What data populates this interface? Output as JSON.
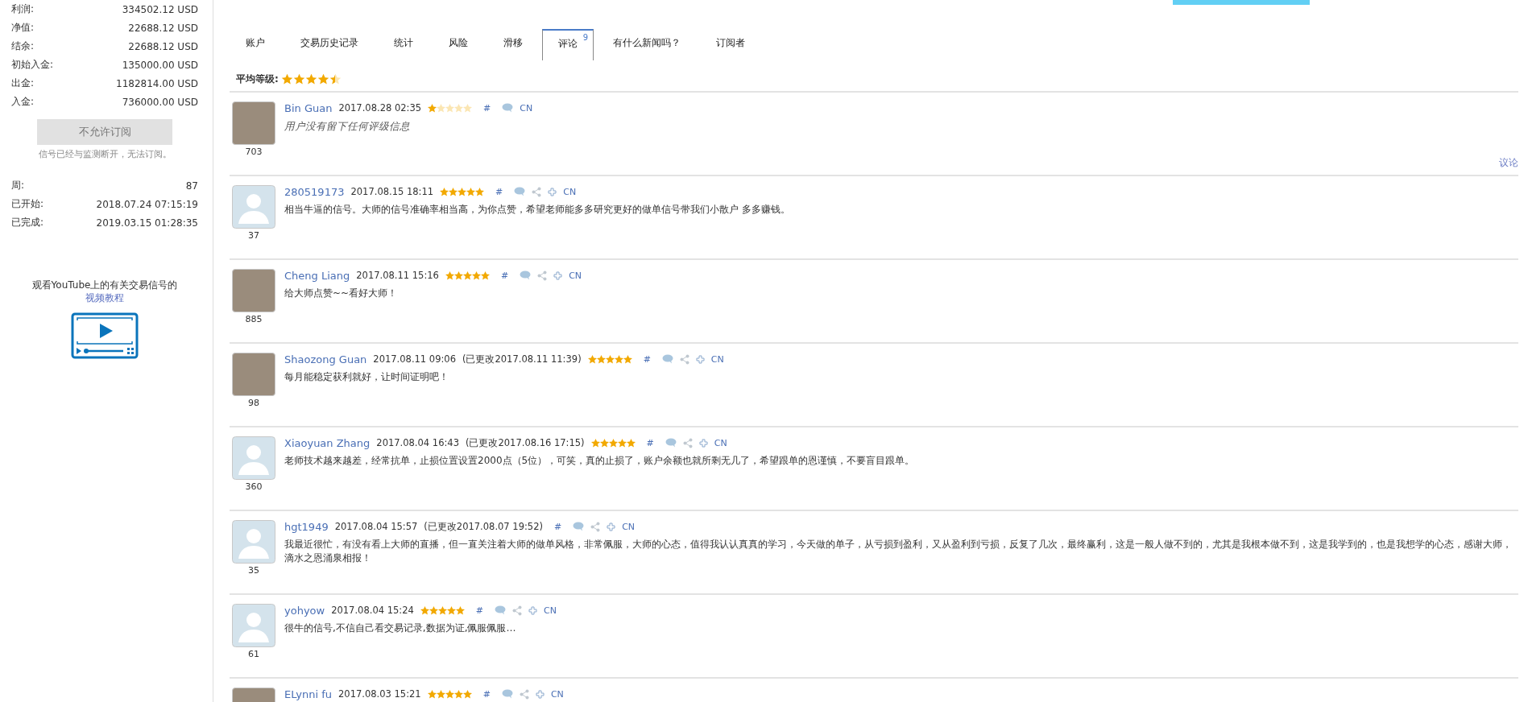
{
  "sidebar": {
    "stats": [
      {
        "label": "利润:",
        "value": "334502.12 USD"
      },
      {
        "label": "净值:",
        "value": "22688.12 USD"
      },
      {
        "label": "结余:",
        "value": "22688.12 USD"
      },
      {
        "label": "初始入金:",
        "value": "135000.00 USD"
      },
      {
        "label": "出金:",
        "value": "1182814.00 USD"
      },
      {
        "label": "入金:",
        "value": "736000.00 USD"
      }
    ],
    "subscribe_button": {
      "label": "不允许订阅",
      "disabled": true
    },
    "subscribe_note": "信号已经与监测断开，无法订阅。",
    "info": [
      {
        "label": "周:",
        "value": "87"
      },
      {
        "label": "已开始:",
        "value": "2018.07.24 07:15:19"
      },
      {
        "label": "已完成:",
        "value": "2019.03.15 01:28:35"
      }
    ],
    "video_text": "观看YouTube上的有关交易信号的",
    "video_link": "视频教程"
  },
  "tabs": [
    {
      "label": "账户",
      "selected": false
    },
    {
      "label": "交易历史记录",
      "selected": false
    },
    {
      "label": "统计",
      "selected": false
    },
    {
      "label": "风险",
      "selected": false
    },
    {
      "label": "滑移",
      "selected": false
    },
    {
      "label": "评论",
      "count": "9",
      "selected": true
    },
    {
      "label": "有什么新闻吗？",
      "selected": false
    },
    {
      "label": "订阅者",
      "selected": false
    }
  ],
  "average_rating": {
    "label": "平均等级:",
    "stars": 4.5
  },
  "comments": [
    {
      "kind": "photo",
      "name": "Bin Guan",
      "date": "2017.08.28 02:35",
      "stars": 1,
      "hash": "#",
      "share": false,
      "lang": "CN",
      "text": "用户没有留下任何评级信息",
      "no_review": true,
      "count": "703",
      "reply": "议论"
    },
    {
      "kind": "default",
      "name": "280519173",
      "date": "2017.08.15 18:11",
      "stars": 5,
      "hash": "#",
      "share": true,
      "lang": "CN",
      "text": "相当牛逼的信号。大师的信号准确率相当高，为你点赞，希望老师能多多研究更好的做单信号带我们小散户 多多赚钱。",
      "no_review": false,
      "count": "37"
    },
    {
      "kind": "photo",
      "name": "Cheng Liang",
      "date": "2017.08.11 15:16",
      "stars": 5,
      "hash": "#",
      "share": true,
      "lang": "CN",
      "text": "给大师点赞~~看好大师！",
      "no_review": false,
      "count": "885"
    },
    {
      "kind": "photo",
      "name": "Shaozong Guan",
      "date": "2017.08.11 09:06",
      "edited": "(已更改2017.08.11 11:39)",
      "stars": 5,
      "hash": "#",
      "share": true,
      "lang": "CN",
      "text": "每月能稳定获利就好，让时间证明吧！",
      "no_review": false,
      "count": "98"
    },
    {
      "kind": "default",
      "name": "Xiaoyuan Zhang",
      "date": "2017.08.04 16:43",
      "edited": "(已更改2017.08.16 17:15)",
      "stars": 5,
      "hash": "#",
      "share": true,
      "lang": "CN",
      "text": "老师技术越来越差，经常抗单，止损位置设置2000点（5位），可笑，真的止损了，账户余额也就所剩无几了，希望跟单的恩谨慎，不要盲目跟单。",
      "no_review": false,
      "count": "360"
    },
    {
      "kind": "default",
      "name": "hgt1949",
      "date": "2017.08.04 15:57",
      "edited": "(已更改2017.08.07 19:52)",
      "hash": "#",
      "share": true,
      "lang": "CN",
      "text": "我最近很忙，有没有看上大师的直播，但一直关注着大师的做单风格，非常佩服，大师的心态，值得我认认真真的学习，今天做的单子，从亏损到盈利，又从盈利到亏损，反复了几次，最终赢利，这是一般人做不到的，尤其是我根本做不到，这是我学到的，也是我想学的心态，感谢大师，滴水之恩涌泉相报！",
      "no_review": false,
      "count": "35"
    },
    {
      "kind": "default",
      "name": "yohyow",
      "date": "2017.08.04 15:24",
      "stars": 5,
      "hash": "#",
      "share": true,
      "lang": "CN",
      "text": "很牛的信号,不信自己看交易记录,数据为证,佩服佩服…",
      "no_review": false,
      "count": "61"
    },
    {
      "kind": "photo",
      "name": "ELynni fu",
      "date": "2017.08.03 15:21",
      "stars": 5,
      "hash": "#",
      "share": true,
      "lang": "CN"
    }
  ]
}
